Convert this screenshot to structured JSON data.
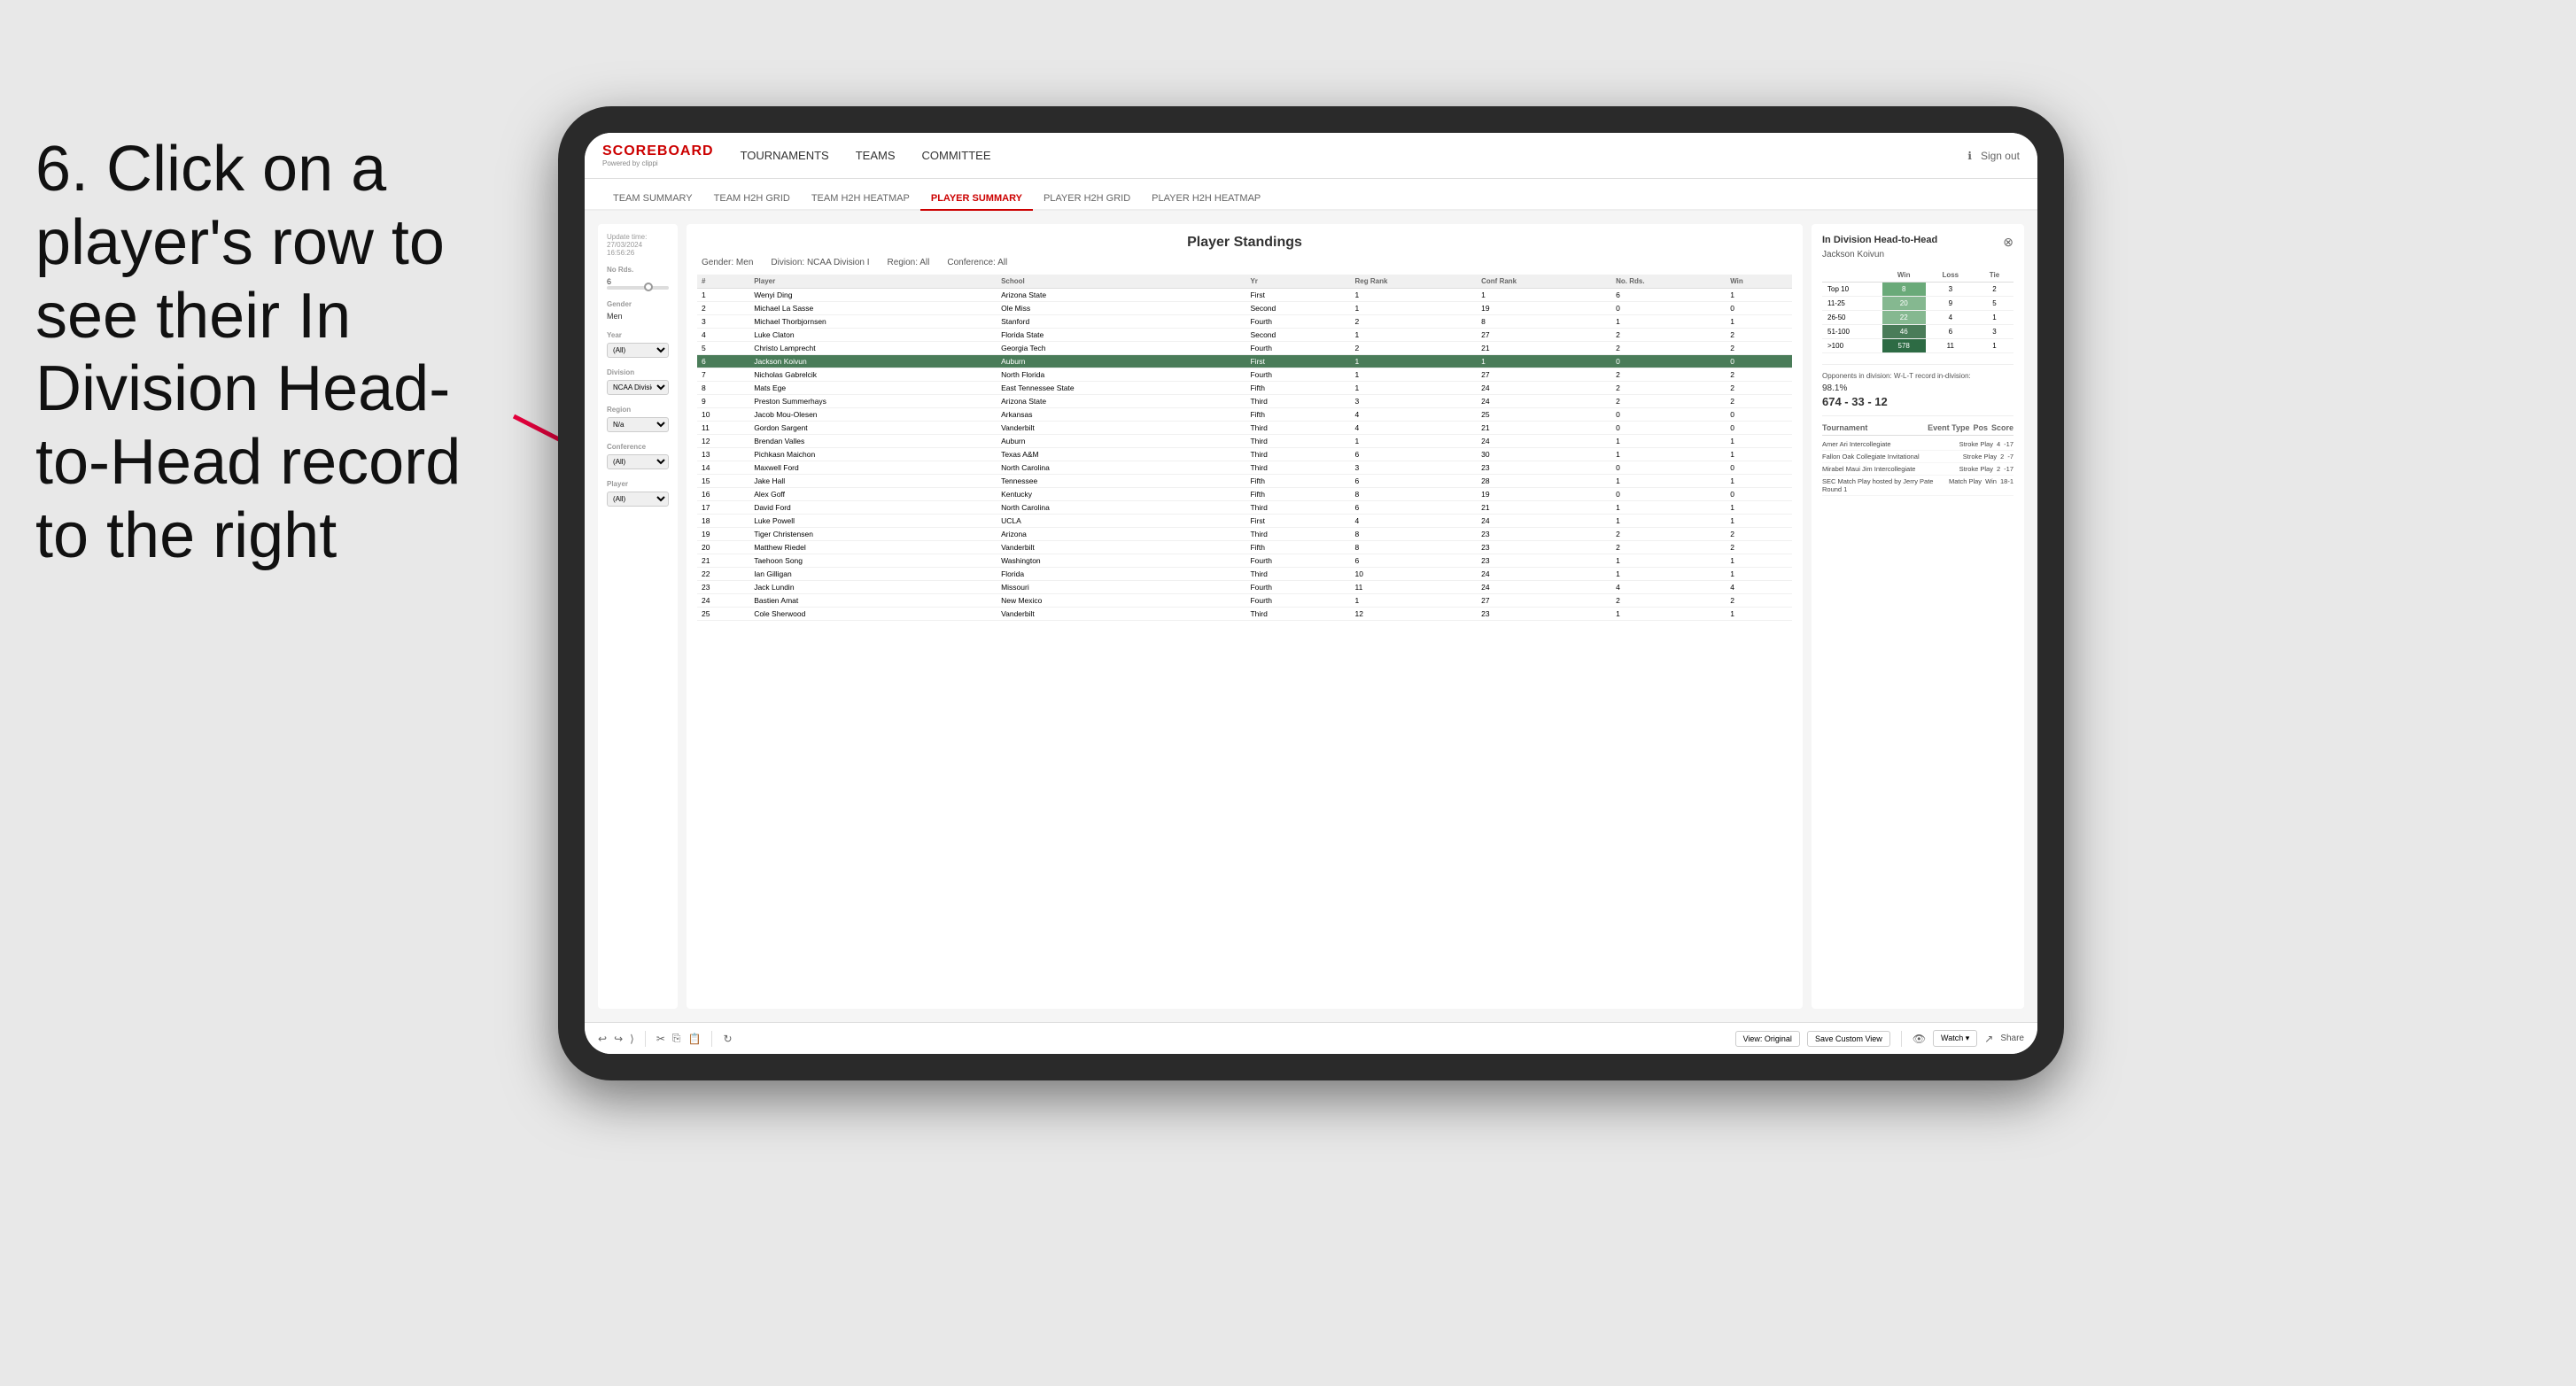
{
  "instruction": {
    "text": "6. Click on a player's row to see their In Division Head-to-Head record to the right"
  },
  "nav": {
    "logo_title": "SCOREBOARD",
    "logo_sub": "Powered by clippi",
    "links": [
      {
        "label": "TOURNAMENTS",
        "active": false
      },
      {
        "label": "TEAMS",
        "active": false
      },
      {
        "label": "COMMITTEE",
        "active": false
      }
    ],
    "sign_out": "Sign out"
  },
  "sub_nav": {
    "links": [
      {
        "label": "TEAM SUMMARY",
        "active": false
      },
      {
        "label": "TEAM H2H GRID",
        "active": false
      },
      {
        "label": "TEAM H2H HEATMAP",
        "active": false
      },
      {
        "label": "PLAYER SUMMARY",
        "active": true
      },
      {
        "label": "PLAYER H2H GRID",
        "active": false
      },
      {
        "label": "PLAYER H2H HEATMAP",
        "active": false
      }
    ]
  },
  "sidebar": {
    "update_label": "Update time:",
    "update_time": "27/03/2024 16:56:26",
    "no_rds_label": "No Rds.",
    "no_rds_value": "6",
    "gender_label": "Gender",
    "gender_value": "Men",
    "year_label": "Year",
    "year_value": "(All)",
    "division_label": "Division",
    "division_value": "NCAA Division I",
    "region_label": "Region",
    "region_value": "N/a",
    "conference_label": "Conference",
    "conference_value": "(All)",
    "player_label": "Player",
    "player_value": "(All)"
  },
  "standings": {
    "title": "Player Standings",
    "gender": "Men",
    "division": "NCAA Division I",
    "region": "All",
    "conference": "All",
    "columns": [
      "#",
      "Player",
      "School",
      "Yr",
      "Reg Rank",
      "Conf Rank",
      "No. Rds.",
      "Win"
    ],
    "rows": [
      {
        "rank": 1,
        "player": "Wenyi Ding",
        "school": "Arizona State",
        "yr": "First",
        "reg": 1,
        "conf": 1,
        "rds": 6,
        "win": 1
      },
      {
        "rank": 2,
        "player": "Michael La Sasse",
        "school": "Ole Miss",
        "yr": "Second",
        "reg": 1,
        "conf": 19,
        "rds": 0,
        "win": 0
      },
      {
        "rank": 3,
        "player": "Michael Thorbjornsen",
        "school": "Stanford",
        "yr": "Fourth",
        "reg": 2,
        "conf": 8,
        "rds": 1,
        "win": 1
      },
      {
        "rank": 4,
        "player": "Luke Claton",
        "school": "Florida State",
        "yr": "Second",
        "reg": 1,
        "conf": 27,
        "rds": 2,
        "win": 2
      },
      {
        "rank": 5,
        "player": "Christo Lamprecht",
        "school": "Georgia Tech",
        "yr": "Fourth",
        "reg": 2,
        "conf": 21,
        "rds": 2,
        "win": 2
      },
      {
        "rank": 6,
        "player": "Jackson Koivun",
        "school": "Auburn",
        "yr": "First",
        "reg": 1,
        "conf": 1,
        "rds": 0,
        "win": 0,
        "highlighted": true
      },
      {
        "rank": 7,
        "player": "Nicholas Gabrelcik",
        "school": "North Florida",
        "yr": "Fourth",
        "reg": 1,
        "conf": 27,
        "rds": 2,
        "win": 2
      },
      {
        "rank": 8,
        "player": "Mats Ege",
        "school": "East Tennessee State",
        "yr": "Fifth",
        "reg": 1,
        "conf": 24,
        "rds": 2,
        "win": 2
      },
      {
        "rank": 9,
        "player": "Preston Summerhays",
        "school": "Arizona State",
        "yr": "Third",
        "reg": 3,
        "conf": 24,
        "rds": 2,
        "win": 2
      },
      {
        "rank": 10,
        "player": "Jacob Mou-Olesen",
        "school": "Arkansas",
        "yr": "Fifth",
        "reg": 4,
        "conf": 25,
        "rds": 0,
        "win": 0
      },
      {
        "rank": 11,
        "player": "Gordon Sargent",
        "school": "Vanderbilt",
        "yr": "Third",
        "reg": 4,
        "conf": 21,
        "rds": 0,
        "win": 0
      },
      {
        "rank": 12,
        "player": "Brendan Valles",
        "school": "Auburn",
        "yr": "Third",
        "reg": 1,
        "conf": 24,
        "rds": 1,
        "win": 1
      },
      {
        "rank": 13,
        "player": "Pichkasn Maichon",
        "school": "Texas A&M",
        "yr": "Third",
        "reg": 6,
        "conf": 30,
        "rds": 1,
        "win": 1
      },
      {
        "rank": 14,
        "player": "Maxwell Ford",
        "school": "North Carolina",
        "yr": "Third",
        "reg": 3,
        "conf": 23,
        "rds": 0,
        "win": 0
      },
      {
        "rank": 15,
        "player": "Jake Hall",
        "school": "Tennessee",
        "yr": "Fifth",
        "reg": 6,
        "conf": 28,
        "rds": 1,
        "win": 1
      },
      {
        "rank": 16,
        "player": "Alex Goff",
        "school": "Kentucky",
        "yr": "Fifth",
        "reg": 8,
        "conf": 19,
        "rds": 0,
        "win": 0
      },
      {
        "rank": 17,
        "player": "David Ford",
        "school": "North Carolina",
        "yr": "Third",
        "reg": 6,
        "conf": 21,
        "rds": 1,
        "win": 1
      },
      {
        "rank": 18,
        "player": "Luke Powell",
        "school": "UCLA",
        "yr": "First",
        "reg": 4,
        "conf": 24,
        "rds": 1,
        "win": 1
      },
      {
        "rank": 19,
        "player": "Tiger Christensen",
        "school": "Arizona",
        "yr": "Third",
        "reg": 8,
        "conf": 23,
        "rds": 2,
        "win": 2
      },
      {
        "rank": 20,
        "player": "Matthew Riedel",
        "school": "Vanderbilt",
        "yr": "Fifth",
        "reg": 8,
        "conf": 23,
        "rds": 2,
        "win": 2
      },
      {
        "rank": 21,
        "player": "Taehoon Song",
        "school": "Washington",
        "yr": "Fourth",
        "reg": 6,
        "conf": 23,
        "rds": 1,
        "win": 1
      },
      {
        "rank": 22,
        "player": "Ian Gilligan",
        "school": "Florida",
        "yr": "Third",
        "reg": 10,
        "conf": 24,
        "rds": 1,
        "win": 1
      },
      {
        "rank": 23,
        "player": "Jack Lundin",
        "school": "Missouri",
        "yr": "Fourth",
        "reg": 11,
        "conf": 24,
        "rds": 4,
        "win": 4
      },
      {
        "rank": 24,
        "player": "Bastien Amat",
        "school": "New Mexico",
        "yr": "Fourth",
        "reg": 1,
        "conf": 27,
        "rds": 2,
        "win": 2
      },
      {
        "rank": 25,
        "player": "Cole Sherwood",
        "school": "Vanderbilt",
        "yr": "Third",
        "reg": 12,
        "conf": 23,
        "rds": 1,
        "win": 1
      }
    ]
  },
  "h2h_panel": {
    "title": "In Division Head-to-Head",
    "player": "Jackson Koivun",
    "table_headers": [
      "",
      "Win",
      "Loss",
      "Tie"
    ],
    "table_rows": [
      {
        "label": "Top 10",
        "win": 8,
        "loss": 3,
        "tie": 2,
        "win_class": "cell-green-light"
      },
      {
        "label": "11-25",
        "win": 20,
        "loss": 9,
        "tie": 5,
        "win_class": "cell-green-med"
      },
      {
        "label": "26-50",
        "win": 22,
        "loss": 4,
        "tie": 1,
        "win_class": "cell-green-med"
      },
      {
        "label": "51-100",
        "win": 46,
        "loss": 6,
        "tie": 3,
        "win_class": "cell-green"
      },
      {
        "label": ">100",
        "win": 578,
        "loss": 11,
        "tie": 1,
        "win_class": "cell-green-dark"
      }
    ],
    "opponents_label": "Opponents in division:",
    "pct": "98.1%",
    "wlt": "674 - 33 - 12",
    "tournaments_headers": [
      "Tournament",
      "Event Type",
      "Pos",
      "Score"
    ],
    "tournaments": [
      {
        "tournament": "Amer Ari Intercollegiate",
        "event_type": "Stroke Play",
        "pos": 4,
        "score": -17
      },
      {
        "tournament": "Fallon Oak Collegiate Invitational",
        "event_type": "Stroke Play",
        "pos": 2,
        "score": -7
      },
      {
        "tournament": "Mirabel Maui Jim Intercollegiate",
        "event_type": "Stroke Play",
        "pos": 2,
        "score": -17
      },
      {
        "tournament": "SEC Match Play hosted by Jerry Pate Round 1",
        "event_type": "Match Play",
        "pos": "Win",
        "score": "18-1"
      }
    ]
  },
  "toolbar": {
    "view_original": "View: Original",
    "save_custom": "Save Custom View",
    "watch": "Watch ▾",
    "share": "Share"
  }
}
